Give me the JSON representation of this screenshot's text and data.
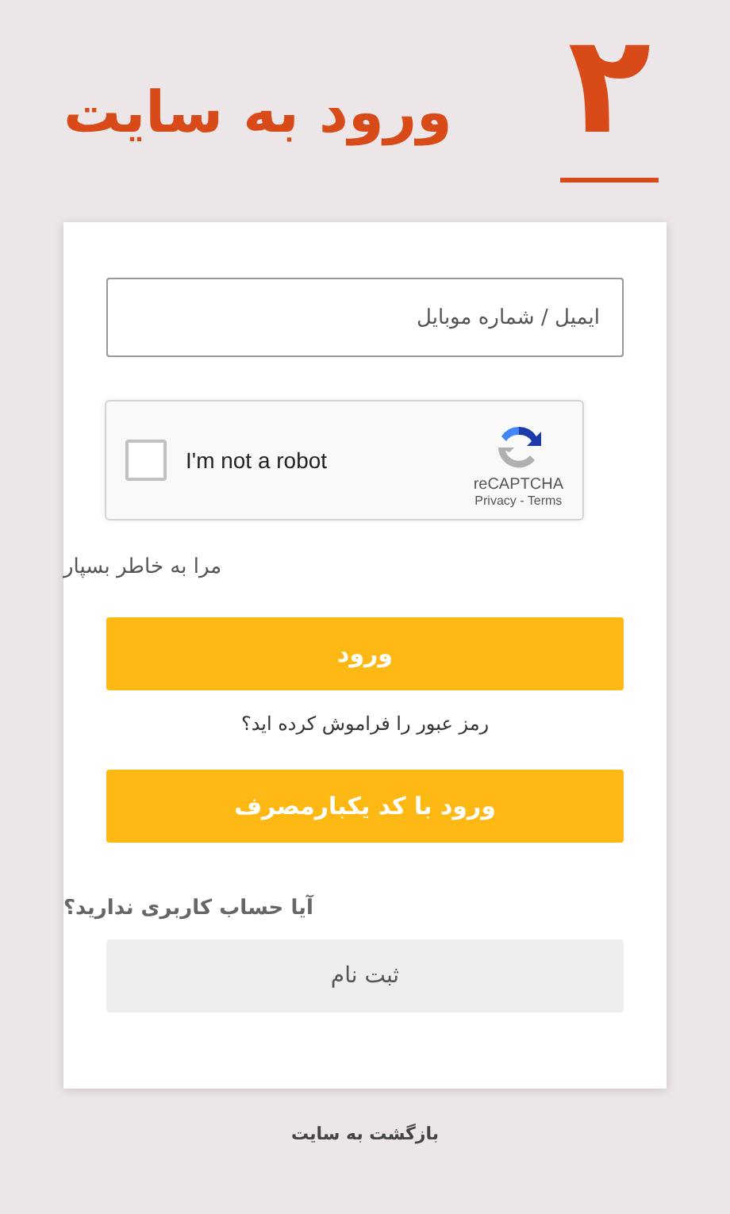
{
  "header": {
    "title": "ورود به سایت",
    "step": "۲"
  },
  "form": {
    "username": {
      "placeholder": "ایمیل / شماره موبایل"
    },
    "captcha": {
      "label": "I'm not a robot",
      "checked": false,
      "brand": "reCAPTCHA",
      "links": "Privacy - Terms"
    },
    "remember": {
      "label": "مرا به خاطر بسپار"
    },
    "login_button": "ورود",
    "forgot_link": "رمز عبور را فراموش کرده اید؟",
    "otp_button": "ورود با کد یکبارمصرف"
  },
  "signup": {
    "question": "آیا حساب کاربری ندارید؟",
    "button": "ثبت نام"
  },
  "back_link": {
    "label": "بازگشت به سایت"
  }
}
